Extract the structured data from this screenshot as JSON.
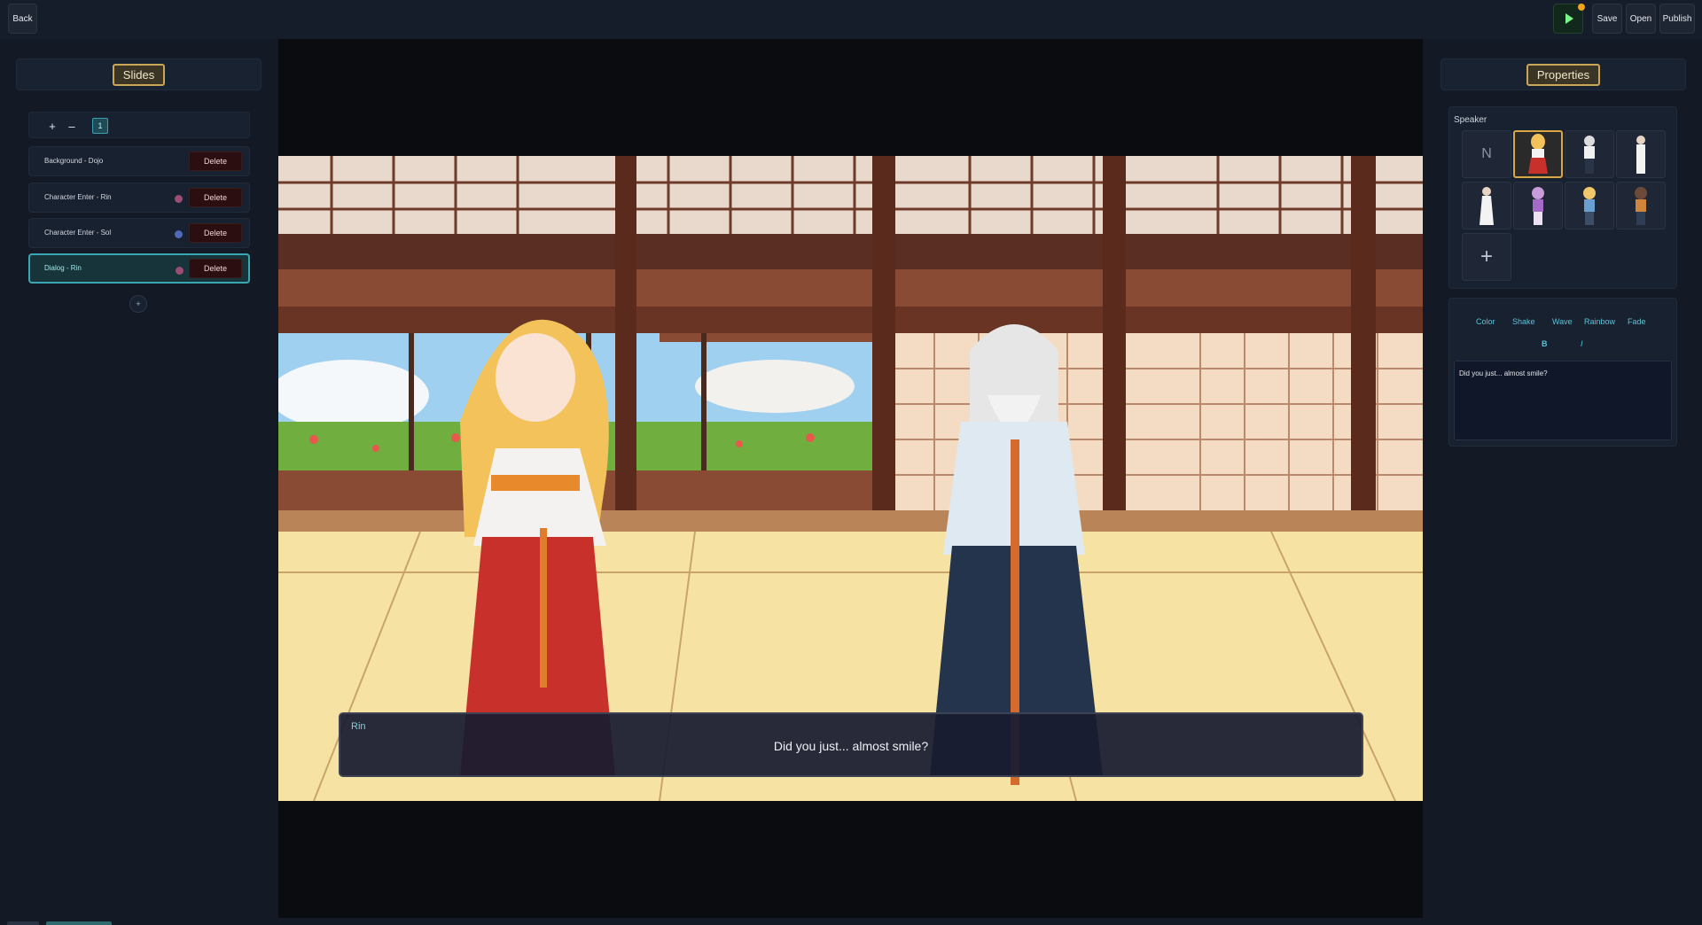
{
  "topbar": {
    "back": "Back",
    "save": "Save",
    "open": "Open",
    "publish": "Publish",
    "play_icon": "play-icon"
  },
  "slides_panel": {
    "title": "Slides",
    "controls": {
      "add": "+",
      "remove": "–",
      "page": "1"
    },
    "items": [
      {
        "label": "Background - Dojo",
        "delete": "Delete",
        "dot_color": ""
      },
      {
        "label": "Character Enter - Rin",
        "delete": "Delete",
        "dot_color": "#9c4d73"
      },
      {
        "label": "Character Enter - Sol",
        "delete": "Delete",
        "dot_color": "#4f68b8"
      },
      {
        "label": "Dialog - Rin",
        "delete": "Delete",
        "dot_color": "#9c4d73",
        "active": true
      }
    ],
    "add_slide": "+"
  },
  "dialog": {
    "speaker": "Rin",
    "text": "Did you just... almost smile?"
  },
  "properties": {
    "title": "Properties",
    "speaker_label": "Speaker",
    "none_option": "N",
    "add_character": "+",
    "effects": [
      "Color",
      "Shake",
      "Wave",
      "Rainbow",
      "Fade"
    ],
    "format": [
      "B",
      "I"
    ],
    "text_value": "Did you just... almost smile?"
  },
  "colors": {
    "accent_teal": "#3aa7b3",
    "accent_gold": "#caa657",
    "delete_bg": "#2b0e10",
    "play_green": "#7cf58a"
  }
}
